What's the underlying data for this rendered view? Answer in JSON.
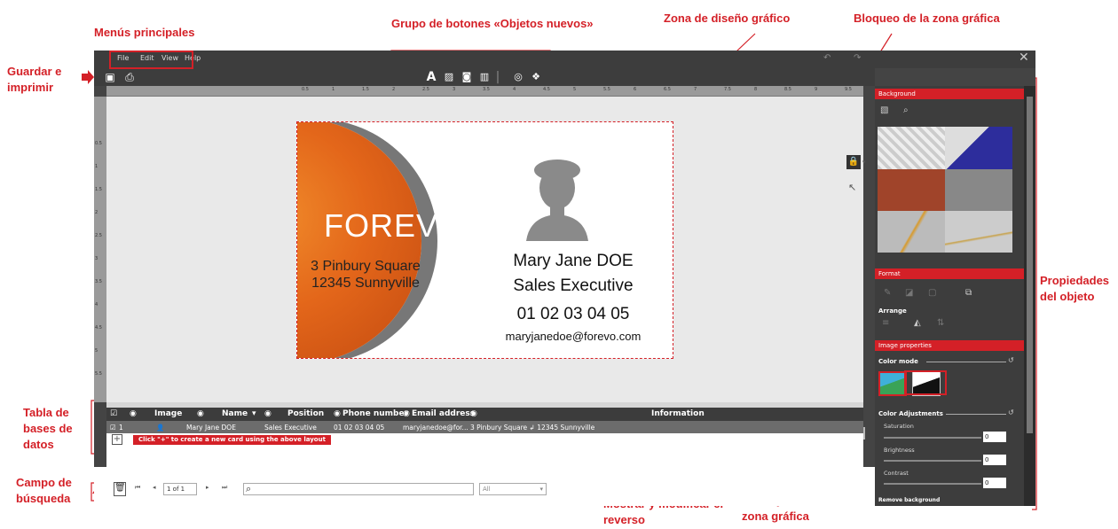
{
  "annotations": {
    "menus": "Menús principales",
    "save_print": "Guardar e imprimir",
    "new_objects": "Grupo de botones «Objetos nuevos»",
    "design_zone": "Zona de diseño gráfico",
    "lock_zone": "Bloqueo de la zona gráfica",
    "properties": "Propiedades del objeto",
    "db_table": "Tabla de bases de datos",
    "search_field": "Campo de búsqueda",
    "reverse": "Mostrar y modificar el reverso",
    "zoom": "Zoom y centrado en la zona gráfica"
  },
  "menu": {
    "file": "File",
    "edit": "Edit",
    "view": "View",
    "help": "Help"
  },
  "card": {
    "brand": "FOREVO",
    "address1": "3 Pinbury Square",
    "address2": "12345 Sunnyville",
    "name": "Mary Jane DOE",
    "title": "Sales Executive",
    "phone": "01 02 03 04 05",
    "email": "maryjanedoe@forevo.com"
  },
  "grid": {
    "headers": [
      "Image",
      "Name",
      "Position",
      "Phone number",
      "Email address",
      "Information"
    ],
    "row": {
      "index": "1",
      "name": "Mary Jane DOE",
      "position": "Sales Executive",
      "phone": "01 02 03 04 05",
      "email": "maryjanedoe@for...",
      "info": "3 Pinbury Square ↲ 12345 Sunnyville"
    },
    "hint": "Click \"+\" to create a new card using the above layout"
  },
  "pager": {
    "page": "1 of 1",
    "filter": "All"
  },
  "panel": {
    "background": "Background",
    "format": "Format",
    "arrange": "Arrange",
    "image_properties": "Image properties",
    "color_mode": "Color mode",
    "color_adjustments": "Color Adjustments",
    "saturation": "Saturation",
    "brightness": "Brightness",
    "contrast": "Contrast",
    "remove_background": "Remove background",
    "saturation_value": "0",
    "brightness_value": "0",
    "contrast_value": "0"
  },
  "ruler": {
    "h": [
      "0.5",
      "1",
      "1.5",
      "2",
      "2.5",
      "3",
      "3.5",
      "4",
      "4.5",
      "5",
      "5.5",
      "6",
      "6.5",
      "7",
      "7.5",
      "8",
      "8.5",
      "9",
      "9.5",
      "10",
      "10.5",
      "11",
      "11.5",
      "12"
    ],
    "v": [
      "0.5",
      "1",
      "1.5",
      "2",
      "2.5",
      "3",
      "3.5",
      "4",
      "4.5",
      "5",
      "5.5"
    ]
  },
  "colors": {
    "accent": "#d42027",
    "orange": "#e3661a",
    "dark": "#3d3d3d"
  }
}
